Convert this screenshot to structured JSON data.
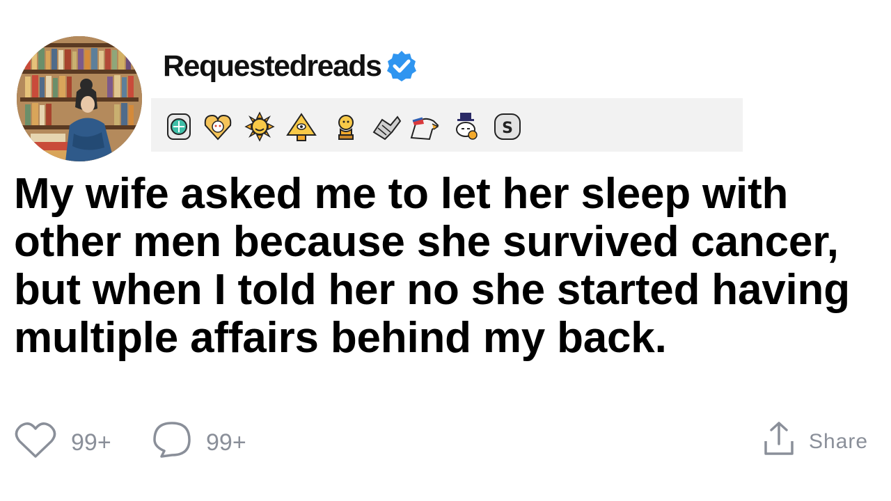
{
  "post": {
    "username": "Requestedreads",
    "verified": true,
    "title": "My wife asked me to let her sleep with other men because she survived cancer, but when I told her no she started having multiple affairs behind my back.",
    "awards": [
      {
        "icon": "platinum-award-icon"
      },
      {
        "icon": "wholesome-award-icon"
      },
      {
        "icon": "sun-award-icon"
      },
      {
        "icon": "illuminati-award-icon"
      },
      {
        "icon": "gold-award-icon"
      },
      {
        "icon": "handshake-award-icon"
      },
      {
        "icon": "eagle-award-icon"
      },
      {
        "icon": "snoo-award-icon"
      },
      {
        "icon": "silver-award-icon"
      }
    ],
    "likes": "99+",
    "comments": "99+",
    "share_label": "Share"
  },
  "colors": {
    "verified": "#2f95f0",
    "meta_text": "#8a8f99",
    "awards_bg": "#f2f2f2"
  }
}
